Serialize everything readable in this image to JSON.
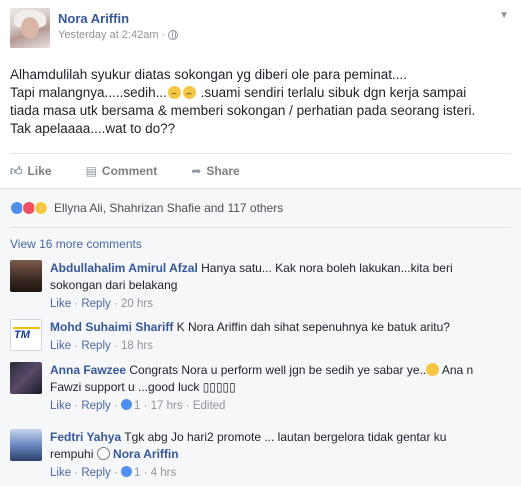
{
  "post": {
    "author": "Nora Ariffin",
    "timestamp": "Yesterday at 2:42am",
    "separator": "·",
    "privacy_icon": "globe-icon",
    "menu_icon": "chevron-down-icon",
    "text_line1": "Alhamdulilah syukur diatas sokongan yg diberi ole para peminat....",
    "text_line2_before": "Tapi malangnya.....sedih...",
    "text_line2_after": " .suami sendiri terlalu sibuk dgn kerja sampai",
    "text_line3": "tiada masa utk bersama & memberi sokongan / perhatian pada seorang isteri.",
    "text_line4": "Tak apelaaaa....wat to do??",
    "emoji_icon": "crying-face-icon"
  },
  "actions": {
    "like_label": "Like",
    "comment_label": "Comment",
    "share_label": "Share"
  },
  "reactions": {
    "icons": [
      "like-reaction-icon",
      "love-reaction-icon",
      "sad-reaction-icon"
    ],
    "summary": "Ellyna Ali, Shahrizan Shafie and 117 others"
  },
  "view_more": "View 16 more comments",
  "comments": [
    {
      "name": "Abdullahalim Amirul Afzal",
      "text_line1": " Hanya satu... Kak nora boleh lakukan...kita beri",
      "text_line2": "sokongan dari belakang",
      "like": "Like",
      "reply": "Reply",
      "time": "20 hrs"
    },
    {
      "name": "Mohd Suhaimi Shariff",
      "text_line1": " K Nora Ariffin dah sihat sepenuhnya ke batuk aritu?",
      "like": "Like",
      "reply": "Reply",
      "time": "18 hrs",
      "avatar_text": "TM"
    },
    {
      "name": "Anna Fawzee",
      "text_line1": " Congrats Nora u perform well jgn be sedih ye sabar ye..",
      "text_line1_end": " Ana n",
      "text_line2": "Fawzi support u ...good luck ▯▯▯▯▯",
      "like": "Like",
      "reply": "Reply",
      "likes_count": "1",
      "time": "17 hrs",
      "edited": "Edited"
    },
    {
      "name": "Fedtri Yahya",
      "text_line1": " Tgk abg Jo hari2 promote ... lautan bergelora tidak gentar ku",
      "text_line2_before": "rempuhi ",
      "text_line2_after": " Nora Ariffin",
      "like": "Like",
      "reply": "Reply",
      "likes_count": "1",
      "time": "4 hrs"
    }
  ],
  "colors": {
    "link_blue": "#365899",
    "meta_gray": "#90949c",
    "comments_bg": "#f6f7f9"
  }
}
